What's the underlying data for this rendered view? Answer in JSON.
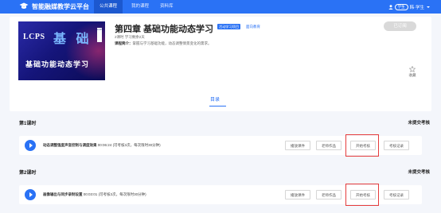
{
  "header": {
    "brand": "智能融媒教学云平台",
    "nav": [
      "公共课程",
      "我的课程",
      "资料库"
    ],
    "active_nav": 0,
    "user_role": "学生",
    "user_name": "韩·学生"
  },
  "course": {
    "cover_lcps": "LCPS",
    "cover_big": "基 础",
    "cover_sub": "基础功能动态学习",
    "cover_badge": "LCPS",
    "title": "第四章 基础功能动态学习",
    "tag": "活动学习项目",
    "tag2": "面向教育",
    "meta": "2课时    学习剩余2天",
    "intro_label": "课程简介：",
    "intro": "掌握与学习基础功能，动态调整情景变化的需求。",
    "done_button": "已订阅",
    "fav_label": "收藏",
    "tab_label": "目录"
  },
  "lessons": [
    {
      "heading": "第1课时",
      "status": "未提交考核",
      "title": "动态调整强度声音控制与调度效果",
      "duration": "00:06:24",
      "detail": "(可考核3次，每次限时30分钟)",
      "buttons": [
        "播放课件",
        "老师作品",
        "开始考核",
        "考核记录"
      ],
      "highlighted_button": 2
    },
    {
      "heading": "第2课时",
      "status": "未提交考核",
      "title": "画像输出与同步录制设置",
      "duration": "00:03:01",
      "detail": "(可考核3次，每次限时30分钟)",
      "buttons": [
        "播放课件",
        "老师作品",
        "开始考核",
        "考核记录"
      ],
      "highlighted_button": 2
    }
  ],
  "colors": {
    "primary": "#2a72f5",
    "highlight_border": "#e53b3b",
    "background": "#f4f6fb"
  },
  "icons": {
    "logo": "graduation-cap-icon",
    "user": "user-icon",
    "favorite": "star-icon",
    "play": "play-icon"
  }
}
